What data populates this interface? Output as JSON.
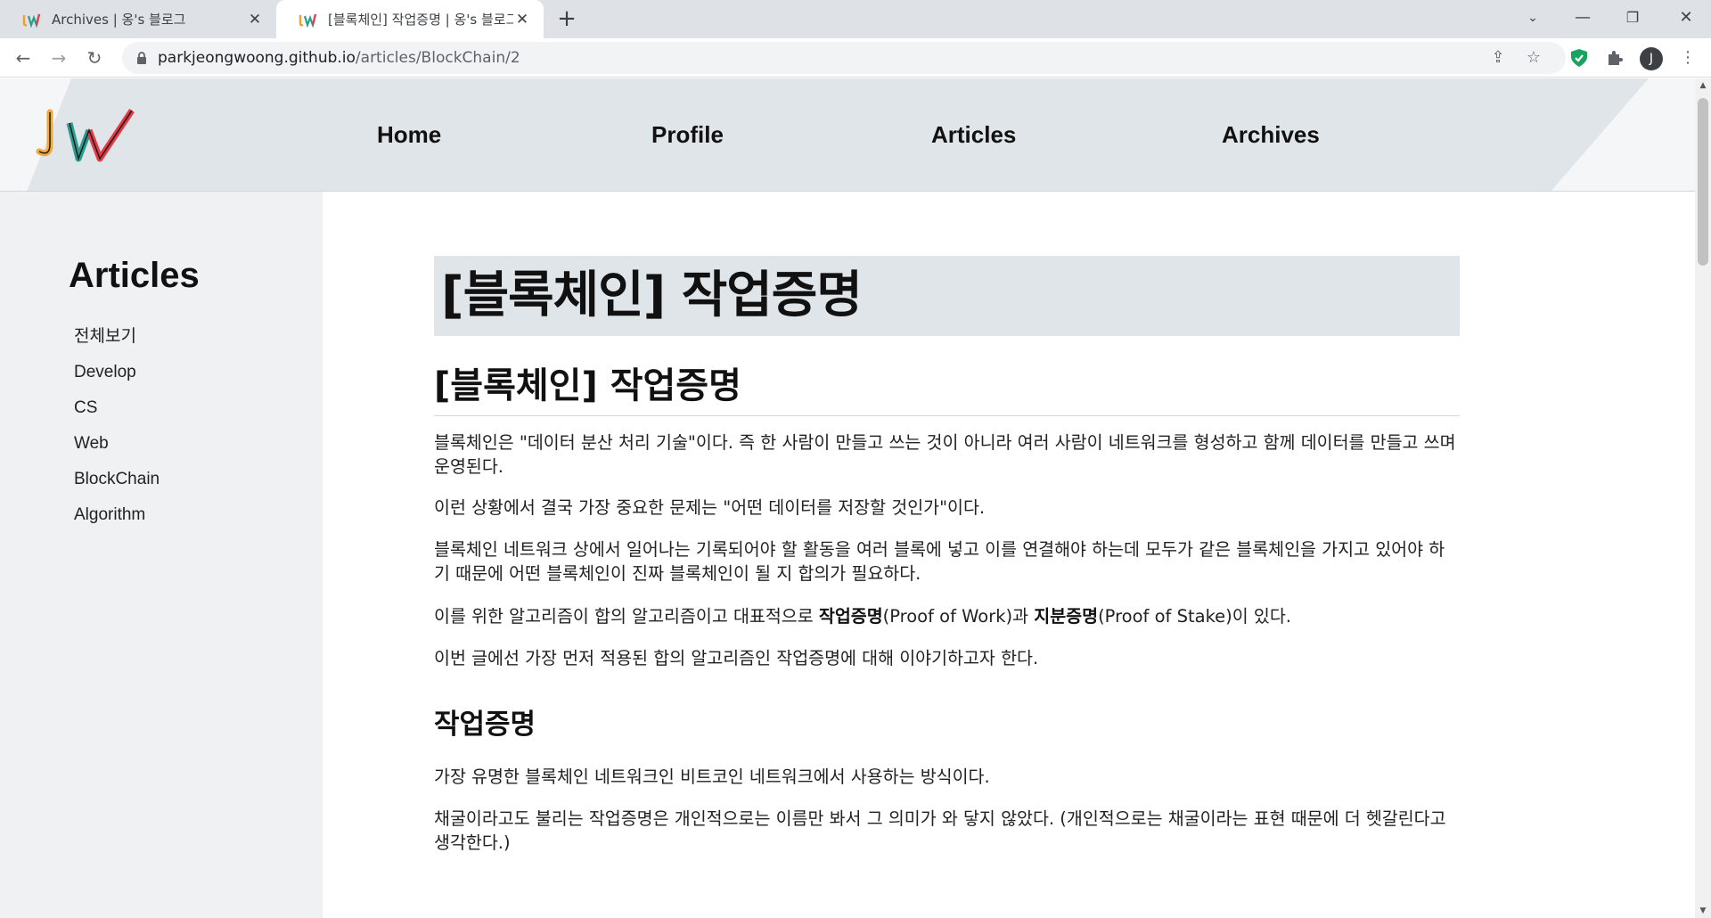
{
  "browser": {
    "tabs": [
      {
        "title": "Archives | 옹's 블로그",
        "active": false
      },
      {
        "title": "[블록체인] 작업증명 | 옹's 블로그",
        "active": true
      }
    ],
    "url_host": "parkjeongwoong.github.io",
    "url_path": "/articles/BlockChain/2",
    "avatar_letter": "J"
  },
  "site": {
    "logo_text": "JW",
    "nav": [
      "Home",
      "Profile",
      "Articles",
      "Archives"
    ]
  },
  "sidebar": {
    "title": "Articles",
    "items": [
      "전체보기",
      "Develop",
      "CS",
      "Web",
      "BlockChain",
      "Algorithm"
    ]
  },
  "article": {
    "title": "[블록체인] 작업증명",
    "heading": "[블록체인] 작업증명",
    "p1": "블록체인은 \"데이터 분산 처리 기술\"이다. 즉 한 사람이 만들고 쓰는 것이 아니라 여러 사람이 네트워크를 형성하고 함께 데이터를 만들고 쓰며 운영된다.",
    "p2": "이런 상황에서 결국 가장 중요한 문제는 \"어떤 데이터를 저장할 것인가\"이다.",
    "p3": "블록체인 네트워크 상에서 일어나는 기록되어야 할 활동을 여러 블록에 넣고 이를 연결해야 하는데 모두가 같은 블록체인을 가지고 있어야 하기 때문에 어떤 블록체인이 진짜 블록체인이 될 지 합의가 필요하다.",
    "p4_a": "이를 위한 알고리즘이 합의 알고리즘이고 대표적으로 ",
    "p4_b": "작업증명",
    "p4_c": "(Proof of Work)과 ",
    "p4_d": "지분증명",
    "p4_e": "(Proof of Stake)이 있다.",
    "p5": "이번 글에선 가장 먼저 적용된 합의 알고리즘인 작업증명에 대해 이야기하고자 한다.",
    "subheading": "작업증명",
    "p6": "가장 유명한 블록체인 네트워크인 비트코인 네트워크에서 사용하는 방식이다.",
    "p7": "채굴이라고도 불리는 작업증명은 개인적으로는 이름만 봐서 그 의미가 와 닿지 않았다. (개인적으로는 채굴이라는 표현 때문에 더 헷갈린다고 생각한다.)"
  }
}
